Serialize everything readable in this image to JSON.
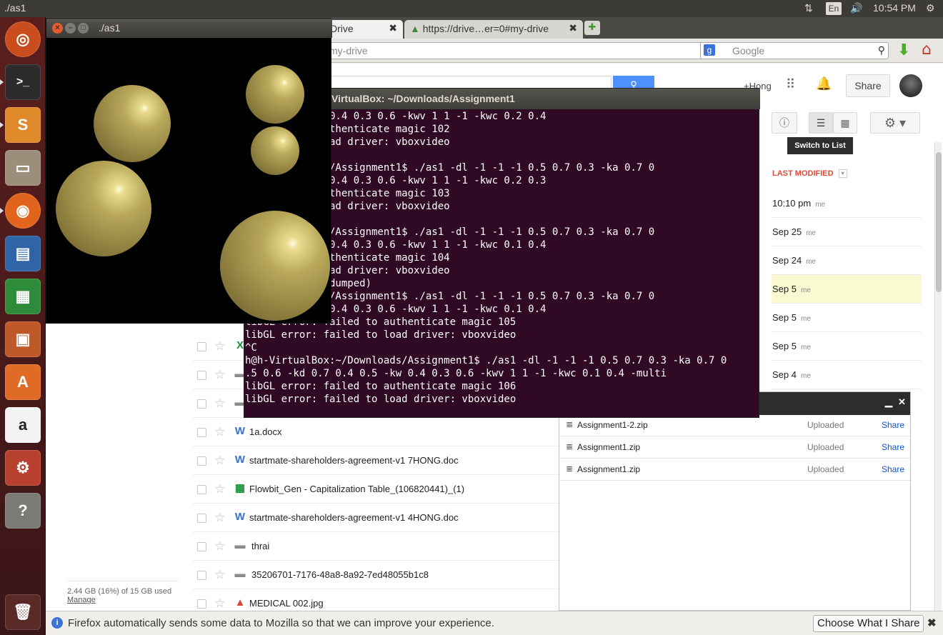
{
  "top_panel": {
    "title": "./as1",
    "keyboard": "En",
    "time": "10:54 PM"
  },
  "launcher": {
    "items": [
      "ubuntu-dash",
      "terminal",
      "sublime-text",
      "files",
      "firefox",
      "libreoffice-impress",
      "libreoffice-calc",
      "libreoffice-impress-2",
      "software-center",
      "amazon",
      "system-settings",
      "help",
      "trash"
    ]
  },
  "browser": {
    "tabs": [
      {
        "label": "Drive"
      },
      {
        "label": "https://drive…er=0#my-drive"
      }
    ],
    "url": "my-drive",
    "search_placeholder": "Google"
  },
  "drive": {
    "user": "+Hong",
    "share_label": "Share",
    "tooltip": "Switch to List",
    "column_header": "LAST MODIFIED",
    "rows_right": [
      {
        "date": "10:10 pm",
        "owner": "me"
      },
      {
        "date": "Sep 25",
        "owner": "me"
      },
      {
        "date": "Sep 24",
        "owner": "me"
      },
      {
        "date": "Sep 5",
        "owner": "me"
      },
      {
        "date": "Sep 5",
        "owner": "me"
      },
      {
        "date": "Sep 5",
        "owner": "me"
      },
      {
        "date": "Sep 4",
        "owner": "me"
      }
    ],
    "files": [
      {
        "name": "",
        "icon": "X",
        "color": "#1d8f3c"
      },
      {
        "name": "",
        "icon": "folder",
        "color": "#8a8a8a"
      },
      {
        "name": "",
        "icon": "folder",
        "color": "#8a8a8a"
      },
      {
        "name": "1a.docx",
        "icon": "W",
        "color": "#3b6fd6"
      },
      {
        "name": "startmate-shareholders-agreement-v1 7HONG.doc",
        "icon": "W",
        "color": "#3b6fd6"
      },
      {
        "name": "Flowbit_Gen - Capitalization Table_(106820441)_(1)",
        "icon": "sheet",
        "color": "#1d8f3c"
      },
      {
        "name": "startmate-shareholders-agreement-v1 4HONG.doc",
        "icon": "W",
        "color": "#3b6fd6"
      },
      {
        "name": "thrai",
        "icon": "folder",
        "color": "#8a8a8a"
      },
      {
        "name": "35206701-7176-48a8-8a92-7ed48055b1c8",
        "icon": "folder",
        "color": "#8a8a8a"
      },
      {
        "name": "MEDICAL 002.jpg",
        "icon": "image",
        "color": "#d9453b"
      }
    ],
    "storage": "2.44 GB (16%) of 15 GB used",
    "manage": "Manage",
    "uploads": [
      {
        "name": "Assignment1-2.zip",
        "status": "Uploaded",
        "action": "Share"
      },
      {
        "name": "Assignment1.zip",
        "status": "Uploaded",
        "action": "Share"
      },
      {
        "name": "Assignment1.zip",
        "status": "Uploaded",
        "action": "Share"
      }
    ]
  },
  "terminal": {
    "title": "VirtualBox: ~/Downloads/Assignment1",
    "lines": [
      "  0.4 0.5 -kw 0.4 0.3 0.6 -kwv 1 1 -1 -kwc 0.2 0.4",
      "  failed to authenticate magic 102",
      "  failed to load driver: vboxvideo",
      "",
      "  :~/Downloads/Assignment1$ ./as1 -dl -1 -1 -1 0.5 0.7 0.3 -ka 0.7 0",
      "  0.4 0.5 -kw 0.4 0.3 0.6 -kwv 1 1 -1 -kwc 0.2 0.3",
      "  failed to authenticate magic 103",
      "  failed to load driver: vboxvideo",
      "",
      "  :~/Downloads/Assignment1$ ./as1 -dl -1 -1 -1 0.5 0.7 0.3 -ka 0.7 0",
      "  0.4 0.5 -kw 0.4 0.3 0.6 -kwv 1 1 -1 -kwc 0.1 0.4",
      "  failed to authenticate magic 104",
      "  failed to load driver: vboxvideo",
      "  fault (core dumped)",
      "  :~/Downloads/Assignment1$ ./as1 -dl -1 -1 -1 0.5 0.7 0.3 -ka 0.7 0",
      "  0.4 0.5 -kw 0.4 0.3 0.6 -kwv 1 1 -1 -kwc 0.1 0.4",
      "libGL error: failed to authenticate magic 105",
      "libGL error: failed to load driver: vboxvideo",
      "^C",
      "h@h-VirtualBox:~/Downloads/Assignment1$ ./as1 -dl -1 -1 -1 0.5 0.7 0.3 -ka 0.7 0",
      ".5 0.6 -kd 0.7 0.4 0.5 -kw 0.4 0.3 0.6 -kwv 1 1 -1 -kwc 0.1 0.4 -multi",
      "libGL error: failed to authenticate magic 106",
      "libGL error: failed to load driver: vboxvideo"
    ]
  },
  "as1_window": {
    "title": "./as1"
  },
  "notification": {
    "text": "Firefox automatically sends some data to Mozilla so that we can improve your experience.",
    "button": "Choose What I Share"
  }
}
